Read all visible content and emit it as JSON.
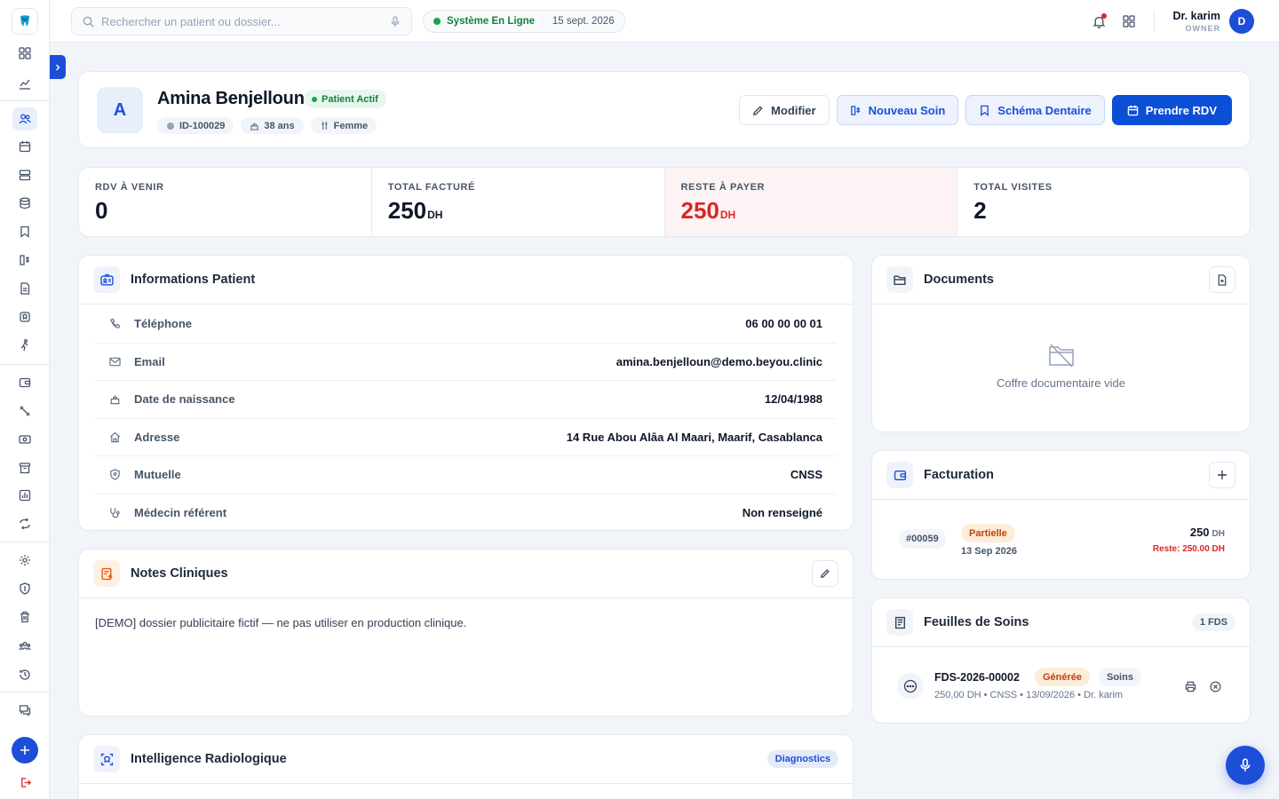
{
  "topbar": {
    "search_placeholder": "Rechercher un patient ou dossier...",
    "system_status": "Système En Ligne",
    "date": "15 sept. 2026",
    "user_name": "Dr. karim",
    "user_role": "OWNER",
    "user_initial": "D"
  },
  "patient": {
    "initial": "A",
    "name": "Amina Benjelloun",
    "status": "Patient Actif",
    "id": "ID-100029",
    "age": "38 ans",
    "gender": "Femme"
  },
  "actions": {
    "edit": "Modifier",
    "new_care": "Nouveau Soin",
    "dental_chart": "Schéma Dentaire",
    "book": "Prendre RDV"
  },
  "stats": [
    {
      "label": "RDV À VENIR",
      "value": "0",
      "unit": ""
    },
    {
      "label": "TOTAL FACTURÉ",
      "value": "250",
      "unit": "DH"
    },
    {
      "label": "RESTE À PAYER",
      "value": "250",
      "unit": "DH"
    },
    {
      "label": "TOTAL VISITES",
      "value": "2",
      "unit": ""
    }
  ],
  "info": {
    "title": "Informations Patient",
    "rows": [
      {
        "label": "Téléphone",
        "value": "06 00 00 00 01",
        "icon": "phone-icon"
      },
      {
        "label": "Email",
        "value": "amina.benjelloun@demo.beyou.clinic",
        "icon": "mail-icon"
      },
      {
        "label": "Date de naissance",
        "value": "12/04/1988",
        "icon": "cake-icon"
      },
      {
        "label": "Adresse",
        "value": "14 Rue Abou Alâa Al Maari, Maarif, Casablanca",
        "icon": "home-icon"
      },
      {
        "label": "Mutuelle",
        "value": "CNSS",
        "icon": "shield-icon"
      },
      {
        "label": "Médecin référent",
        "value": "Non renseigné",
        "icon": "stethoscope-icon"
      }
    ]
  },
  "notes": {
    "title": "Notes Cliniques",
    "text": "[DEMO] dossier publicitaire fictif — ne pas utiliser en production clinique."
  },
  "radiology": {
    "title": "Intelligence Radiologique",
    "badge": "Diagnostics"
  },
  "documents": {
    "title": "Documents",
    "empty": "Coffre documentaire vide"
  },
  "billing": {
    "title": "Facturation",
    "invoice": {
      "number": "#00059",
      "status": "Partielle",
      "date": "13 Sep 2026",
      "amount": "250",
      "unit": "DH",
      "rest": "Reste: 250.00 DH"
    }
  },
  "sheets": {
    "title": "Feuilles de Soins",
    "count": "1 FDS",
    "item": {
      "code": "FDS-2026-00002",
      "status": "Générée",
      "type": "Soins",
      "meta": "250,00 DH • CNSS • 13/09/2026 • Dr. karim"
    }
  },
  "colors": {
    "primary": "#1d4ed8",
    "success": "#16a34a",
    "danger": "#dc2626",
    "warning": "#c2410c"
  }
}
